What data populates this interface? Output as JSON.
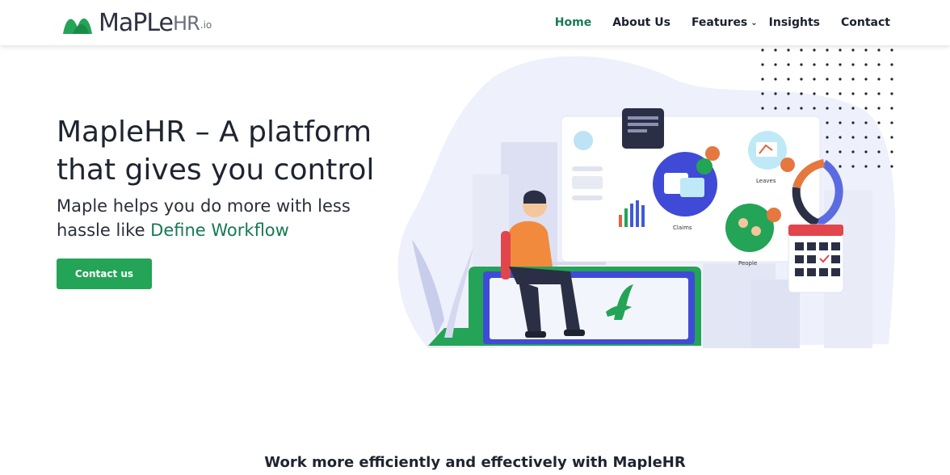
{
  "brand": {
    "name_main": "MaPLe",
    "name_hr": "HR",
    "name_suffix": ".io",
    "color": "#23a456"
  },
  "nav": {
    "items": [
      {
        "label": "Home",
        "active": true
      },
      {
        "label": "About Us"
      },
      {
        "label": "Features",
        "has_dropdown": true
      },
      {
        "label": "Insights"
      },
      {
        "label": "Contact"
      }
    ],
    "active_color": "#177a56"
  },
  "hero": {
    "title": "MapleHR – A platform that gives you control",
    "subtitle_prefix": "Maple helps you do more with less hassle like ",
    "subtitle_accent": "Define Workflow",
    "cta_label": "Contact us",
    "cta_color": "#23a456"
  },
  "illustration": {
    "labels": [
      "Leaves",
      "Claims",
      "People"
    ]
  },
  "section": {
    "heading": "Work more efficiently and effectively with MapleHR"
  }
}
